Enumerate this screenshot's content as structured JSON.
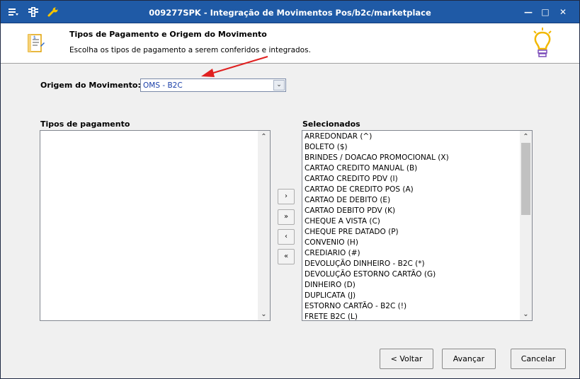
{
  "window": {
    "title": "009277SPK - Integração de Movimentos Pos/b2c/marketplace",
    "minimize": "—",
    "maximize": "□",
    "close": "✕"
  },
  "header": {
    "title": "Tipos de Pagamento e Origem do Movimento",
    "subtitle": "Escolha os tipos de pagamento a serem conferidos e integrados."
  },
  "origem": {
    "label": "Origem do Movimento:",
    "value": "OMS - B2C"
  },
  "tipos": {
    "label": "Tipos de pagamento",
    "items": []
  },
  "selecionados": {
    "label": "Selecionados",
    "items": [
      "ARREDONDAR (^)",
      "BOLETO ($)",
      "BRINDES / DOACAO PROMOCIONAL (X)",
      "CARTAO CREDITO MANUAL (B)",
      "CARTAO CREDITO PDV (I)",
      "CARTAO DE CREDITO POS (A)",
      "CARTAO DE DEBITO (E)",
      "CARTAO DEBITO PDV (K)",
      "CHEQUE A VISTA (C)",
      "CHEQUE PRE DATADO (P)",
      "CONVENIO (H)",
      "CREDIARIO (#)",
      "DEVOLUÇÃO DINHEIRO - B2C (*)",
      "DEVOLUÇÃO ESTORNO CARTÃO (G)",
      "DINHEIRO (D)",
      "DUPLICATA (J)",
      "ESTORNO CARTÃO - B2C (!)",
      "FRETE B2C (L)"
    ]
  },
  "move_buttons": {
    "add_one": "›",
    "add_all": "»",
    "remove_one": "‹",
    "remove_all": "«"
  },
  "footer": {
    "back": "< Voltar",
    "next": "Avançar",
    "cancel": "Cancelar"
  },
  "colors": {
    "titlebar": "#1f5aa6",
    "annotation_arrow": "#e02020",
    "combo_text": "#1a3fa8"
  }
}
